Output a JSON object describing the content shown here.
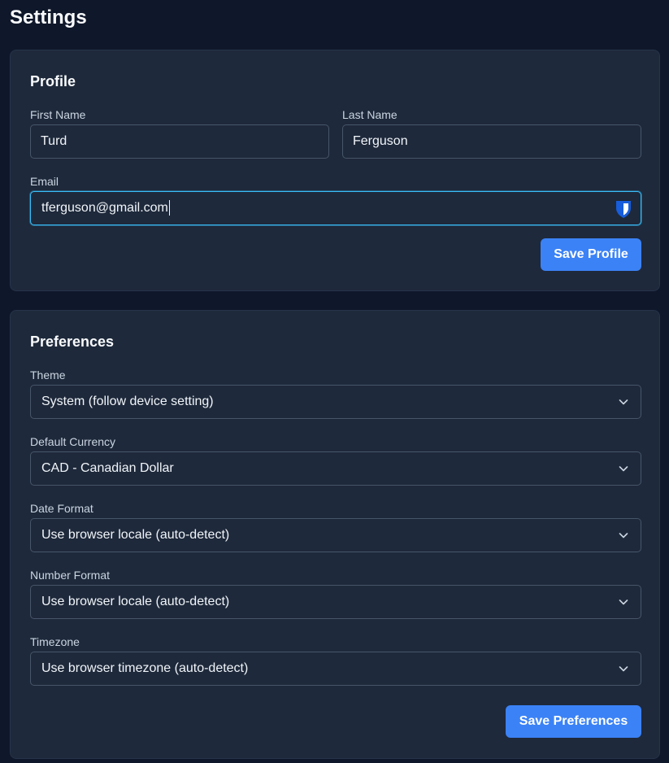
{
  "page": {
    "title": "Settings"
  },
  "profile": {
    "title": "Profile",
    "first_name": {
      "label": "First Name",
      "value": "Turd"
    },
    "last_name": {
      "label": "Last Name",
      "value": "Ferguson"
    },
    "email": {
      "label": "Email",
      "value": "tferguson@gmail.com"
    },
    "save_label": "Save Profile"
  },
  "preferences": {
    "title": "Preferences",
    "theme": {
      "label": "Theme",
      "value": "System (follow device setting)"
    },
    "currency": {
      "label": "Default Currency",
      "value": "CAD - Canadian Dollar"
    },
    "date_format": {
      "label": "Date Format",
      "value": "Use browser locale (auto-detect)"
    },
    "number_format": {
      "label": "Number Format",
      "value": "Use browser locale (auto-detect)"
    },
    "timezone": {
      "label": "Timezone",
      "value": "Use browser timezone (auto-detect)"
    },
    "save_label": "Save Preferences"
  },
  "colors": {
    "background": "#0f172a",
    "card": "#1e293b",
    "accent": "#3b82f6",
    "focus_ring": "#38bdf8",
    "password_manager_icon": "#175ddc"
  },
  "icons": {
    "password_manager": "shield-icon",
    "select_arrow": "chevron-down-icon"
  }
}
